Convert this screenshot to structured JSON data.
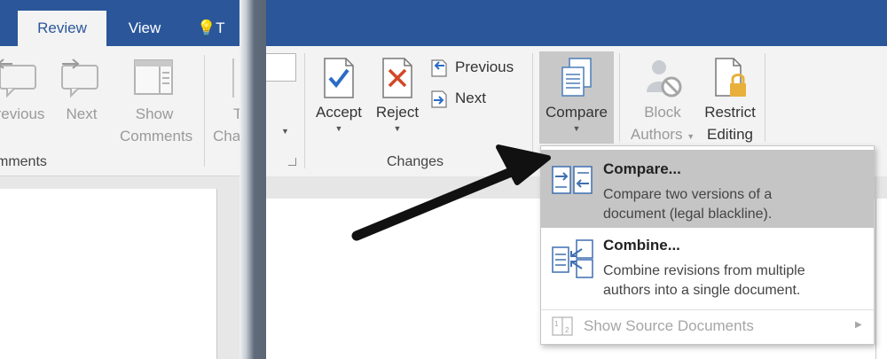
{
  "left_panel": {
    "tabs": {
      "review": "Review",
      "view": "View",
      "tell_me": "T"
    },
    "buttons": {
      "previous": "revious",
      "next": "Next",
      "show_line1": "Show",
      "show_line2": "Comments",
      "track_line1": "T",
      "track_line2": "Cha"
    },
    "group_label": "mments"
  },
  "right_panel": {
    "ribbon": {
      "accept": "Accept",
      "reject": "Reject",
      "previous": "Previous",
      "next": "Next",
      "changes_group": "Changes",
      "compare": "Compare",
      "block_line1": "Block",
      "block_line2": "Authors",
      "restrict_line1": "Restrict",
      "restrict_line2": "Editing"
    },
    "compare_menu": {
      "compare": {
        "title": "Compare...",
        "desc_line1": "Compare two versions of a",
        "desc_line2": "document (legal blackline)."
      },
      "combine": {
        "title": "Combine...",
        "desc_line1": "Combine revisions from multiple",
        "desc_line2": "authors into a single document."
      },
      "show_source": "Show Source Documents"
    }
  },
  "colors": {
    "title_bar": "#2b579a",
    "highlight": "#c5c5c5",
    "accept_check": "#2b6cc4",
    "reject_x": "#d24726"
  }
}
